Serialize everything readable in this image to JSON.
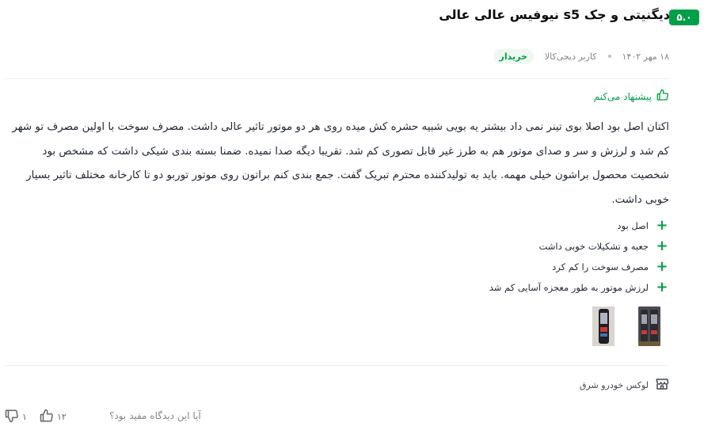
{
  "review": {
    "score": "۵.۰",
    "title": "دیگنیتی و جک s5 نیوفیس عالی عالی",
    "date": "۱۸ مهر ۱۴۰۲",
    "author": "کاربر دیجی‌کالا",
    "buyer_badge": "خریدار",
    "recommend_label": "پیشنهاد می‌کنم",
    "body": "اکتان اصل بود اصلا بوی تینر نمی داد بیشتر یه بویی شبیه حشره کش میده روی هر دو موتور تاثیر عالی داشت. مصرف سوخت با اولین مصرف تو شهر کم شد و لرزش و سر و صدای موتور هم به طرز غیر قابل تصوری کم شد. تقریبا دیگه صدا نمیده. ضمنا بسته بندی شیکی داشت که مشخص بود شخصیت محصول براشون خیلی مهمه. باید به تولیدکننده محترم تبریک گفت. جمع بندی کنم براتون روی موتور توربو دو تا کارخانه مختلف تاثیر بسیار خوبی داشت.",
    "pros": [
      "اصل بود",
      "جعبه و تشکیلات خوبی داشت",
      "مصرف سوخت را کم کرد",
      "لرزش موتور به طور معجزه آسایی کم شد"
    ],
    "seller": "لوکس خودرو شرق",
    "helpful_question": "آیا این دیدگاه مفید بود؟",
    "likes": "۱۲",
    "dislikes": "۱"
  },
  "colors": {
    "accent_green": "#00a049",
    "text": "#232933",
    "muted": "#81858b"
  },
  "icons": {
    "recommend": "thumb-up-icon",
    "pro": "plus-icon",
    "seller": "store-icon",
    "like": "thumb-up-icon",
    "dislike": "thumb-down-icon"
  }
}
